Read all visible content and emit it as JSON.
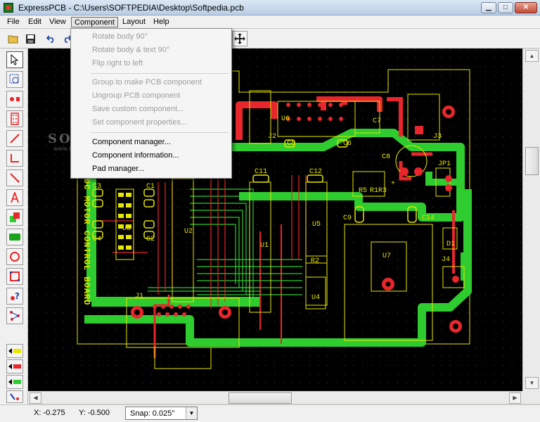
{
  "window": {
    "title": "ExpressPCB - C:\\Users\\SOFTPEDIA\\Desktop\\Softpedia.pcb",
    "min_label": "▁",
    "max_label": "□",
    "close_label": "✕"
  },
  "menu": {
    "file": "File",
    "edit": "Edit",
    "view": "View",
    "component": "Component",
    "layout": "Layout",
    "help": "Help"
  },
  "component_menu": {
    "rotate_body": "Rotate body 90°",
    "rotate_body_text": "Rotate body & text 90°",
    "flip": "Flip right to left",
    "group": "Group to make PCB component",
    "ungroup": "Ungroup PCB component",
    "save_custom": "Save custom component...",
    "set_properties": "Set component properties...",
    "manager": "Component manager...",
    "information": "Component information...",
    "pad_manager": "Pad manager..."
  },
  "canvas": {
    "watermark": "SOFTPEDIA",
    "watermark_sub": "www.softpedia.com",
    "board_text": "DC MOTOR CONTROL BOARD",
    "labels": {
      "j1": "J1",
      "j2": "J2",
      "j3": "J3",
      "j4": "J4",
      "jp1": "JP1",
      "u1": "U1",
      "u2": "U2",
      "u3": "U3",
      "u4": "U4",
      "u5": "U5",
      "u6": "U6",
      "u7": "U7",
      "c1": "C1",
      "c2": "C2",
      "c3": "C3",
      "c4": "C4",
      "c5": "C5",
      "c6": "C6",
      "c7": "C7",
      "c8": "C8",
      "c9": "C9",
      "c11": "C11",
      "c12": "C12",
      "c14": "C14",
      "r1": "R1",
      "r2": "R2",
      "r3": "R3",
      "r5": "R5",
      "d1": "D1",
      "plus": "+"
    }
  },
  "status": {
    "x": "X: -0.275",
    "y": "Y: -0.500",
    "snap": "Snap:  0.025\""
  },
  "colors": {
    "copper_top": "#e8262b",
    "copper_bottom": "#2ecc2e",
    "silkscreen": "#e6e600",
    "grid": "#4a4a4a"
  }
}
